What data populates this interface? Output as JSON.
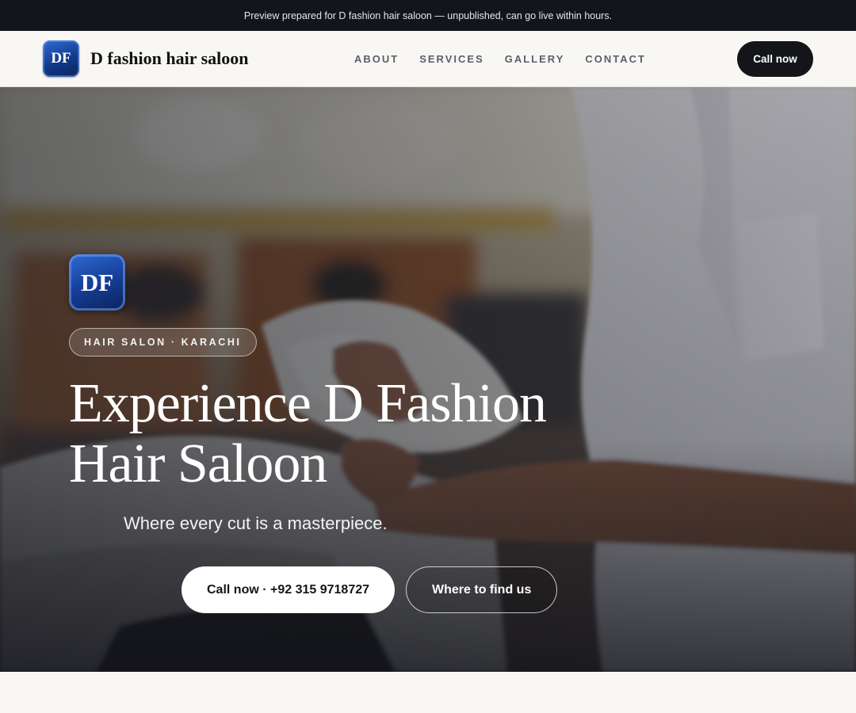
{
  "announcement": "Preview prepared for D fashion hair saloon — unpublished, can go live within hours.",
  "brand": {
    "logo_text": "DF",
    "name": "D fashion hair saloon"
  },
  "nav": {
    "links": [
      {
        "label": "ABOUT"
      },
      {
        "label": "SERVICES"
      },
      {
        "label": "GALLERY"
      },
      {
        "label": "CONTACT"
      }
    ],
    "call_label": "Call now"
  },
  "hero": {
    "logo_text": "DF",
    "badge": "HAIR SALON · KARACHI",
    "title_line1": "Experience D Fashion",
    "title_line2": "Hair Saloon",
    "subtitle": "Where every cut is a masterpiece.",
    "primary_cta": "Call now · +92 315 9718727",
    "secondary_cta": "Where to find us"
  },
  "colors": {
    "topbar_bg": "#12151b",
    "page_bg": "#f8f7f4",
    "logo_blue": "#163f98",
    "dark_button": "#13151a"
  }
}
